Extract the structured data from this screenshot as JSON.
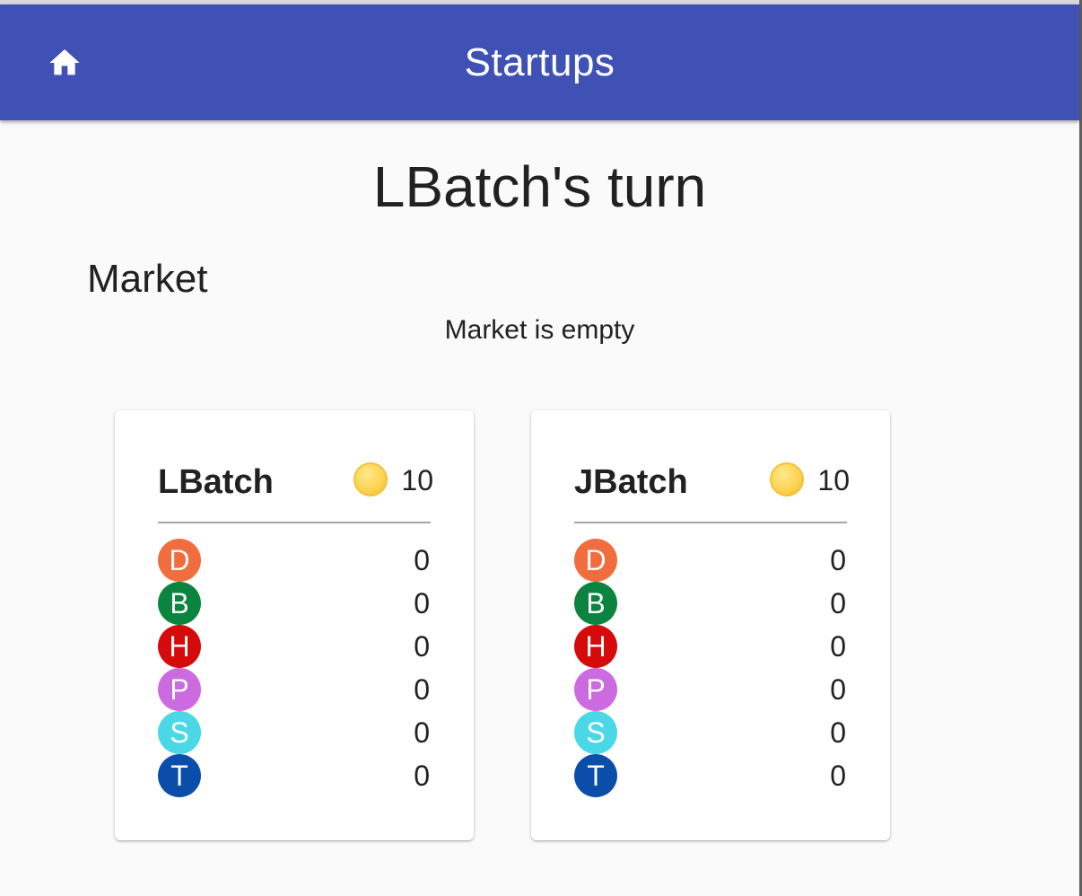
{
  "appbar": {
    "title": "Startups",
    "home_icon": "home-icon",
    "color": "#3f51b5"
  },
  "turn": {
    "heading": "LBatch's turn"
  },
  "market": {
    "heading": "Market",
    "empty_text": "Market is empty"
  },
  "players": [
    {
      "name": "LBatch",
      "coins": "10",
      "coin_icon": "coin-icon",
      "stocks": [
        {
          "letter": "D",
          "count": "0",
          "color": "#f26d3d"
        },
        {
          "letter": "B",
          "count": "0",
          "color": "#0b8440"
        },
        {
          "letter": "H",
          "count": "0",
          "color": "#d50a0a"
        },
        {
          "letter": "P",
          "count": "0",
          "color": "#cc6be0"
        },
        {
          "letter": "S",
          "count": "0",
          "color": "#4ad8e6"
        },
        {
          "letter": "T",
          "count": "0",
          "color": "#0b4eaa"
        }
      ]
    },
    {
      "name": "JBatch",
      "coins": "10",
      "coin_icon": "coin-icon",
      "stocks": [
        {
          "letter": "D",
          "count": "0",
          "color": "#f26d3d"
        },
        {
          "letter": "B",
          "count": "0",
          "color": "#0b8440"
        },
        {
          "letter": "H",
          "count": "0",
          "color": "#d50a0a"
        },
        {
          "letter": "P",
          "count": "0",
          "color": "#cc6be0"
        },
        {
          "letter": "S",
          "count": "0",
          "color": "#4ad8e6"
        },
        {
          "letter": "T",
          "count": "0",
          "color": "#0b4eaa"
        }
      ]
    }
  ]
}
